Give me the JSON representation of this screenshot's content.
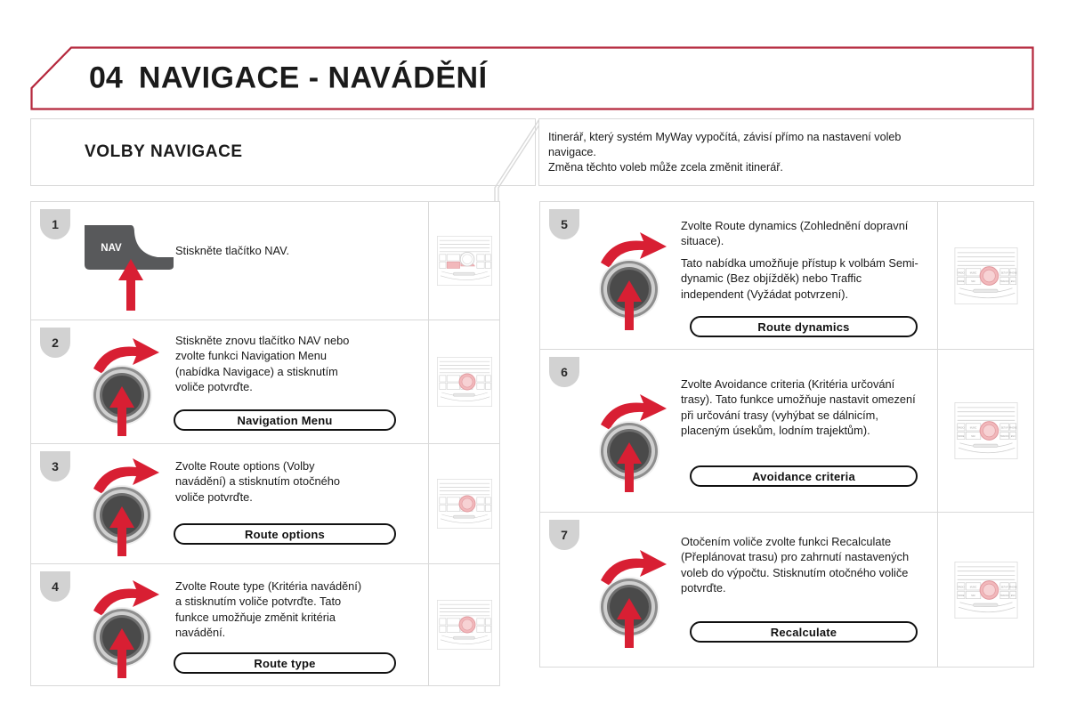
{
  "header": {
    "number": "04",
    "title": "NAVIGACE - NAVÁDĚNÍ",
    "accent_color": "#b5273c",
    "rule_color": "#c0392b"
  },
  "section": {
    "title": "VOLBY NAVIGACE"
  },
  "intro": {
    "line1": "Itinerář, který systém MyWay vypočítá, závisí přímo na nastavení voleb",
    "line2": "navigace.",
    "line3": "Změna těchto voleb může zcela změnit itinerář."
  },
  "radio_face": {
    "buttons_top": [
      "RADIO",
      "MUSIC",
      "SETUP",
      "PHONE"
    ],
    "buttons_bottom": [
      "MODE",
      "NAV",
      "TRAFFIC",
      "ESC"
    ],
    "highlight_color": "#f2b8bb",
    "knob_highlight_color": "#f2b8bb"
  },
  "steps_left": [
    {
      "number": "1",
      "art": "nav-button",
      "lines": [
        "Stiskněte tlačítko NAV."
      ],
      "button_label": "NAV",
      "pill": null,
      "thumb_highlight": "nav-key"
    },
    {
      "number": "2",
      "art": "rotary-knob",
      "lines": [
        "Stiskněte znovu tlačítko NAV nebo",
        "zvolte funkci Navigation Menu",
        "(nabídka Navigace) a stisknutím",
        "voliče potvrďte."
      ],
      "pill": "Navigation Menu",
      "thumb_highlight": "knob"
    },
    {
      "number": "3",
      "art": "rotary-knob",
      "lines": [
        "Zvolte Route options (Volby",
        "navádění) a stisknutím otočného",
        "voliče potvrďte."
      ],
      "pill": "Route options",
      "thumb_highlight": "knob"
    },
    {
      "number": "4",
      "art": "rotary-knob",
      "lines": [
        "Zvolte Route type (Kritéria navádění)",
        "a stisknutím voliče potvrďte. Tato",
        "funkce umožňuje změnit kritéria",
        "navádění."
      ],
      "pill": "Route type",
      "thumb_highlight": "knob"
    }
  ],
  "steps_right": [
    {
      "number": "5",
      "art": "rotary-knob",
      "paragraphs": [
        "Zvolte Route dynamics (Zohlednění dopravní situace).",
        "Tato nabídka umožňuje přístup k volbám Semi-dynamic (Bez objížděk) nebo Traffic independent (Vyžádat potvrzení)."
      ],
      "pill": "Route dynamics",
      "thumb_highlight": "knob"
    },
    {
      "number": "6",
      "art": "rotary-knob",
      "paragraphs": [
        "Zvolte Avoidance criteria (Kritéria určování trasy). Tato funkce umožňuje nastavit omezení při určování trasy (vyhýbat se dálnicím, placeným úsekům, lodním trajektům)."
      ],
      "pill": "Avoidance criteria",
      "thumb_highlight": "knob"
    },
    {
      "number": "7",
      "art": "rotary-knob",
      "paragraphs": [
        "Otočením voliče zvolte funkci Recalculate (Přeplánovat trasu) pro zahrnutí nastavených voleb do výpočtu. Stisknutím otočného voliče potvrďte."
      ],
      "pill": "Recalculate",
      "thumb_highlight": "knob"
    }
  ]
}
